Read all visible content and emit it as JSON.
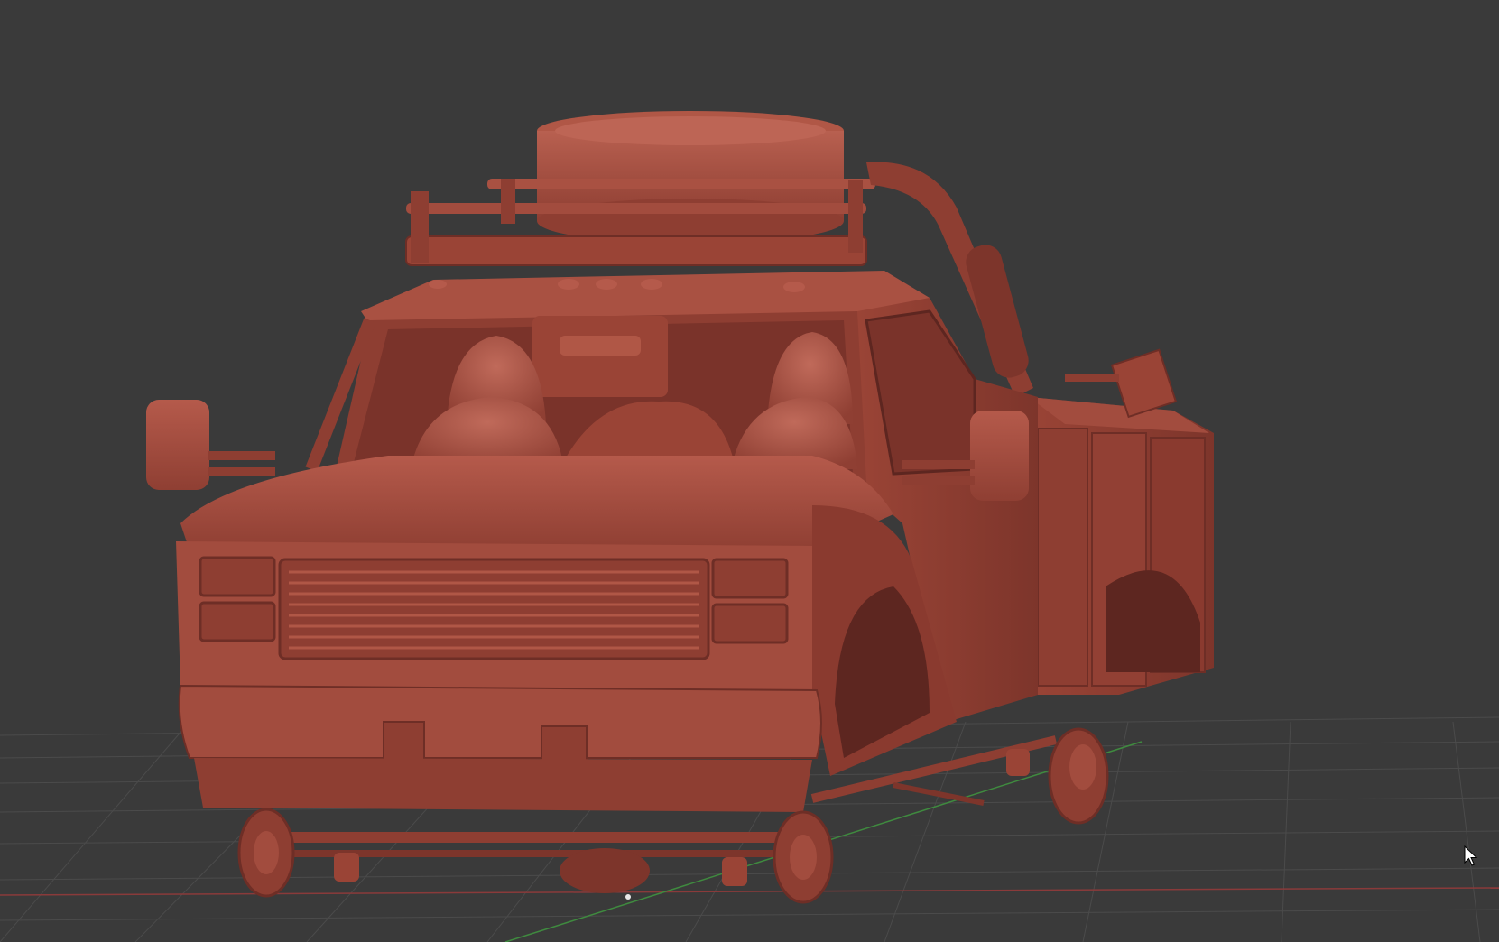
{
  "viewport": {
    "background": "#3a3a3a",
    "grid_color": "#4a4a4a",
    "x_axis_color": "#8a3a3a",
    "y_axis_color": "#3f8a3f",
    "shading_mode": "clay"
  },
  "model": {
    "subject": "utility-service-truck",
    "material_color": "#a1493b",
    "material_light": "#bd6555",
    "material_dark": "#6e2e26",
    "material_shadow": "#4f1f1a"
  },
  "cursor": {
    "icon": "arrow-pointer-icon"
  }
}
